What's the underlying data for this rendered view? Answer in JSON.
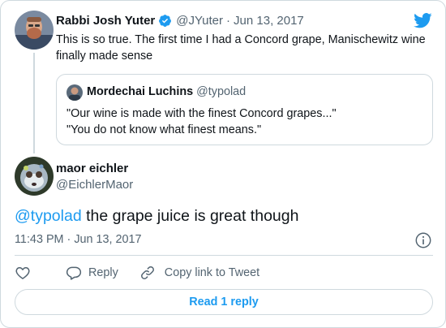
{
  "parent_tweet": {
    "author_name": "Rabbi Josh Yuter",
    "author_handle": "@JYuter",
    "separator": "·",
    "date": "Jun 13, 2017",
    "text": "This is so true. The first time I had a Concord grape, Manischewitz wine finally made sense"
  },
  "quoted_tweet": {
    "author_name": "Mordechai Luchins",
    "author_handle": "@typolad",
    "line1": "\"Our wine is made with the finest Concord grapes...\"",
    "line2": "\"You do not know what finest means.\""
  },
  "main_tweet": {
    "author_name": "maor eichler",
    "author_handle": "@EichlerMaor",
    "mention": "@typolad",
    "text_rest": " the grape juice is great though",
    "timestamp": "11:43 PM · Jun 13, 2017"
  },
  "actions": {
    "reply_label": "Reply",
    "copy_link_label": "Copy link to Tweet"
  },
  "read_replies_label": "Read 1 reply",
  "icons": {
    "brand": "twitter-bird-icon",
    "verified": "verified-badge-icon",
    "info": "info-icon",
    "like": "heart-icon",
    "reply": "speech-bubble-icon",
    "copy": "link-icon"
  },
  "colors": {
    "accent": "#1d9bf0",
    "text_primary": "#0f1419",
    "text_secondary": "#536471",
    "border": "#cfd9de"
  }
}
